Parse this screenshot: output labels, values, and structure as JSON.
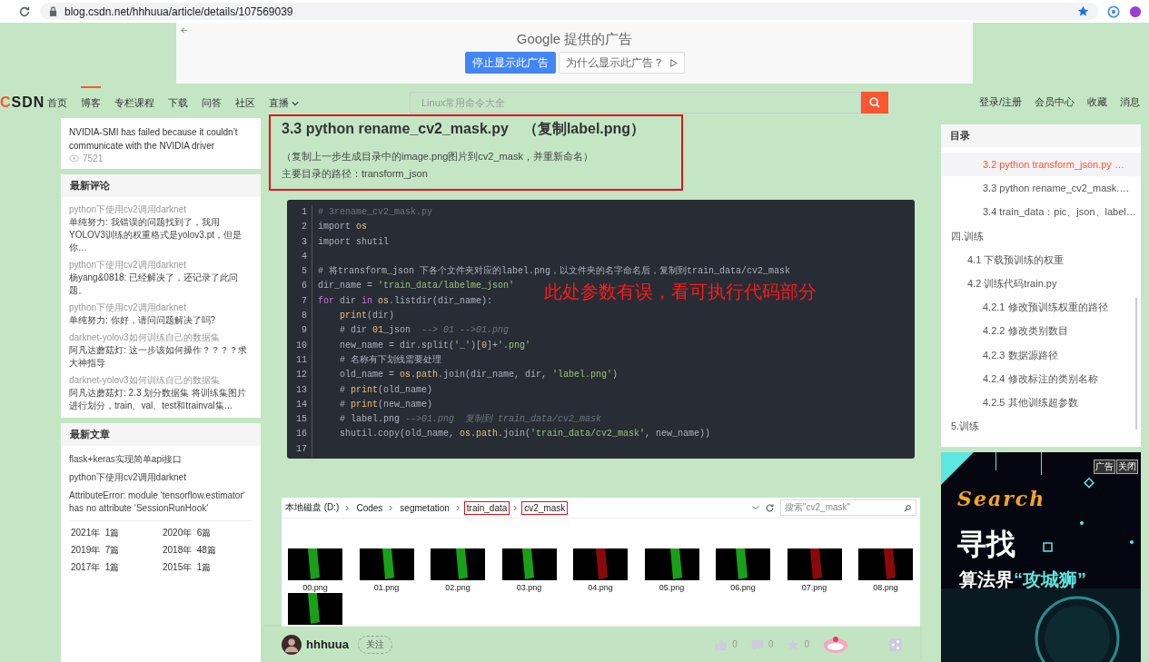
{
  "browser": {
    "url": "blog.csdn.net/hhhuua/article/details/107569039"
  },
  "ad_banner": {
    "title": "Google 提供的广告",
    "buttons": [
      {
        "label": "停止显示此广告",
        "kind": "primary"
      },
      {
        "label": "为什么显示此广告？",
        "kind": "info"
      }
    ]
  },
  "nav": {
    "logo": "CSDN",
    "items": [
      {
        "label": "首页",
        "selected": false
      },
      {
        "label": "博客",
        "selected": true
      },
      {
        "label": "专栏课程",
        "selected": false
      },
      {
        "label": "下载",
        "selected": false
      },
      {
        "label": "问答",
        "selected": false
      },
      {
        "label": "社区",
        "selected": false
      },
      {
        "label": "直播",
        "selected": false,
        "has_menu": true
      }
    ],
    "search": {
      "placeholder": "Linux常用命令大全"
    },
    "links": [
      "登录/注册",
      "会员中心",
      "收藏",
      "消息"
    ]
  },
  "sidebar": {
    "hot_articles": [
      {
        "title": "NVIDIA-SMI has failed because it couldn’t communicate with the NVIDIA driver",
        "views": "7521"
      }
    ],
    "comments": {
      "title": "最新评论",
      "items": [
        {
          "article": "python下使用cv2调用darknet",
          "text": "单纯努力: 我错误的问题找到了，我用YOLOV3训练的权重格式是yolov3.pt，但是你…"
        },
        {
          "article": "python下使用cv2调用darknet",
          "text": "杨yang&0818: 已经解决了，还记录了此问题。"
        },
        {
          "article": "python下使用cv2调用darknet",
          "text": "单纯努力: 你好，请问问题解决了吗?"
        },
        {
          "article": "darknet-yolov3如何训练自己的数据集",
          "text": "阿凡达蘑菇灯: 这一步该如何操作？？？？求大神指导"
        },
        {
          "article": "darknet-yolov3如何训练自己的数据集",
          "text": "阿凡达蘑菇灯: 2.3 划分数据集 将训练集图片进行划分，train、val、test和trainval集…"
        }
      ]
    },
    "recent": {
      "title": "最新文章",
      "items": [
        "flask+keras实现简单api接口",
        "python下使用cv2调用darknet",
        "AttributeError: module ‘tensorflow.estimator‘ has no attribute ‘SessionRunHook‘"
      ],
      "archive": [
        {
          "year": "2021年",
          "count": "1篇"
        },
        {
          "year": "2020年",
          "count": "6篇"
        },
        {
          "year": "2019年",
          "count": "7篇"
        },
        {
          "year": "2018年",
          "count": "48篇"
        },
        {
          "year": "2017年",
          "count": "1篇"
        },
        {
          "year": "2015年",
          "count": "1篇"
        }
      ]
    }
  },
  "article": {
    "heading": "3.3  python rename_cv2_mask.py　（复制label.png）",
    "paragraphs": [
      "（复制上一步生成目录中的image.png图片到cv2_mask，并重新命名）",
      "主要目录的路径：transform_json"
    ],
    "code": {
      "lines": [
        {
          "number": "1",
          "tokens": [
            {
              "kind": "comment",
              "text": "# 3rename_cv2_mask.py"
            }
          ]
        },
        {
          "number": "2",
          "tokens": [
            {
              "kind": "plain",
              "text": "import "
            },
            {
              "kind": "builtin",
              "text": "os"
            }
          ]
        },
        {
          "number": "3",
          "tokens": [
            {
              "kind": "plain",
              "text": "import shutil"
            }
          ]
        },
        {
          "number": "4"
        },
        {
          "number": "5",
          "tokens": [
            {
              "kind": "plain",
              "text": "# 将transform_json 下各个文件夹对应的label.png，以文件夹的名字命名后，复制到train_data/cv2_mask"
            }
          ]
        },
        {
          "number": "6",
          "tokens": [
            {
              "kind": "plain",
              "text": "dir_name = "
            },
            {
              "kind": "string",
              "text": "'train_data/labelme_json'"
            }
          ]
        },
        {
          "number": "7",
          "tokens": [
            {
              "kind": "keyword",
              "text": "for"
            },
            {
              "kind": "plain",
              "text": " dir "
            },
            {
              "kind": "keyword",
              "text": "in "
            },
            {
              "kind": "builtin",
              "text": "os"
            },
            {
              "kind": "plain",
              "text": ".listdir(dir_name):"
            }
          ]
        },
        {
          "number": "8",
          "indent": true,
          "tokens": [
            {
              "kind": "builtin",
              "text": "print"
            },
            {
              "kind": "plain",
              "text": "(dir)"
            }
          ]
        },
        {
          "number": "9",
          "indent": true,
          "tokens": [
            {
              "kind": "plain",
              "text": "# dir "
            },
            {
              "kind": "builtin",
              "text": "01"
            },
            {
              "kind": "plain",
              "text": "_json  "
            },
            {
              "kind": "comment",
              "text": "--> 01 -->01.png"
            }
          ]
        },
        {
          "number": "10",
          "indent": true,
          "tokens": [
            {
              "kind": "plain",
              "text": "new_name = dir.split("
            },
            {
              "kind": "string",
              "text": "'_'"
            },
            {
              "kind": "plain",
              "text": ")["
            },
            {
              "kind": "builtin",
              "text": "0"
            },
            {
              "kind": "plain",
              "text": "]+"
            },
            {
              "kind": "string",
              "text": "'.png'"
            }
          ]
        },
        {
          "number": "11",
          "indent": true,
          "tokens": [
            {
              "kind": "plain",
              "text": "# 名称有下划线需要处理"
            }
          ]
        },
        {
          "number": "12",
          "indent": true,
          "tokens": [
            {
              "kind": "plain",
              "text": "old_name = "
            },
            {
              "kind": "builtin",
              "text": "os.path"
            },
            {
              "kind": "plain",
              "text": ".join(dir_name, dir, "
            },
            {
              "kind": "string",
              "text": "'label.png'"
            },
            {
              "kind": "plain",
              "text": ")"
            }
          ]
        },
        {
          "number": "13",
          "indent": true,
          "tokens": [
            {
              "kind": "plain",
              "text": "# "
            },
            {
              "kind": "builtin",
              "text": "print"
            },
            {
              "kind": "plain",
              "text": "(old_name)"
            }
          ]
        },
        {
          "number": "14",
          "indent": true,
          "tokens": [
            {
              "kind": "plain",
              "text": "# "
            },
            {
              "kind": "builtin",
              "text": "print"
            },
            {
              "kind": "plain",
              "text": "(new_name)"
            }
          ]
        },
        {
          "number": "15",
          "indent": true,
          "tokens": [
            {
              "kind": "plain",
              "text": "# label.png "
            },
            {
              "kind": "comment",
              "text": "-->01.png  复制到 train_data/cv2_mask"
            }
          ]
        },
        {
          "number": "16",
          "indent": true,
          "tokens": [
            {
              "kind": "plain",
              "text": "shutil.copy(old_name, "
            },
            {
              "kind": "builtin",
              "text": "os.path"
            },
            {
              "kind": "plain",
              "text": ".join("
            },
            {
              "kind": "string",
              "text": "'train_data/cv2_mask'"
            },
            {
              "kind": "plain",
              "text": ", new_name))"
            }
          ]
        },
        {
          "number": "17"
        }
      ],
      "annotation": "此处参数有误，看可执行代码部分"
    },
    "explorer": {
      "breadcrumbs": [
        {
          "label": "本地磁盘 (D:)",
          "highlighted": false
        },
        {
          "label": "Codes",
          "highlighted": false
        },
        {
          "label": "segmetation",
          "highlighted": false
        },
        {
          "label": "train_data",
          "highlighted": true
        },
        {
          "label": "cv2_mask",
          "highlighted": true
        }
      ],
      "search": {
        "placeholder": "搜索\"cv2_mask\""
      },
      "files": [
        {
          "name": "00.png",
          "color": "#18a018"
        },
        {
          "name": "01.png",
          "color": "#18a018"
        },
        {
          "name": "02.png",
          "color": "#18a018"
        },
        {
          "name": "03.png",
          "color": "#18a018"
        },
        {
          "name": "04.png",
          "color": "#8a0a0a"
        },
        {
          "name": "05.png",
          "color": "#18a018"
        },
        {
          "name": "06.png",
          "color": "#18a018"
        },
        {
          "name": "07.png",
          "color": "#8a0a0a"
        },
        {
          "name": "08.png",
          "color": "#8a0a0a"
        },
        {
          "color": "#18a018"
        }
      ]
    },
    "author": {
      "name": "hhhuua",
      "follow": "关注",
      "likes": "0",
      "comments": "0",
      "favorites": "0"
    }
  },
  "toc": {
    "title": "目录",
    "scrolled_items": [
      {
        "label": "3.2  python transform_json.py  …",
        "selected": true
      },
      {
        "label": "3.3  python rename_cv2_mask.…",
        "selected": false
      },
      {
        "label": "3.4 train_data：pic、json、label…",
        "selected": false
      }
    ],
    "items": [
      {
        "label": "四.训练",
        "selected": false,
        "children": [
          {
            "label": "4.1 下载预训练的权重",
            "selected": false
          },
          {
            "label": "4.2 训练代码train.py",
            "selected": false,
            "children": [
              {
                "label": "4.2.1 修改预训练权重的路径",
                "selected": false
              },
              {
                "label": "4.2.2 修改类别数目",
                "selected": false
              },
              {
                "label": "4.2.3 数据源路径",
                "selected": false
              },
              {
                "label": "4.2.4 修改标注的类别名称",
                "selected": false
              },
              {
                "label": "4.2.5 其他训练超参数",
                "selected": false
              }
            ]
          }
        ]
      },
      {
        "label": "5.训练",
        "selected": false
      }
    ]
  },
  "side_ad": {
    "tags": [
      "广告",
      "关闭"
    ],
    "headline": "Search",
    "title": "寻找",
    "subtitle": "算法界",
    "highlight": "“攻城狮”"
  }
}
